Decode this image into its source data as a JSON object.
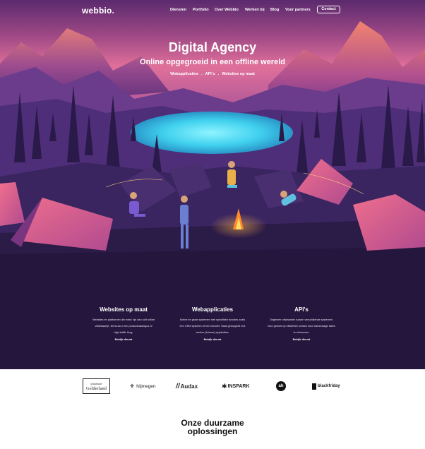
{
  "brand": {
    "logo": "webbio."
  },
  "nav": {
    "items": [
      "Diensten",
      "Portfolio",
      "Over Webbio",
      "Werken bij",
      "Blog",
      "Voor partners"
    ],
    "contact": "Contact"
  },
  "hero": {
    "title": "Digital Agency",
    "subtitle": "Online opgegroeid in een offline wereld",
    "links": [
      "Webapplicaties",
      "API´s",
      "Websites op maat"
    ],
    "separator": "."
  },
  "services": [
    {
      "title": "Websites op maat",
      "text": [
        "Websites en platformen die extra' rijn dan ooit online",
        "visitekaartje. Denk aa n een productcatalogus of",
        "high-traffic blog."
      ],
      "link": "Bekijk dienst"
    },
    {
      "title": "Webapplicaties",
      "text": [
        "Kleine en grote systemen met specifieke functies zoals",
        "een CRM systeem of een intranet. Vaak gekoppeld met",
        "andere (interne) applicaties."
      ],
      "link": "Bekijk dienst"
    },
    {
      "title": "API's",
      "text": [
        "Ongeveer uitwisselen tussen verschillende systemen.",
        "Voor gericht op efficiënter werken door handmatige taken",
        "te elimineren."
      ],
      "link": "Bekijk dienst"
    }
  ],
  "clients": [
    {
      "name": "provincie Gelderland",
      "top": "provincie",
      "bottom": "Gelderland"
    },
    {
      "name": "Nijmegen"
    },
    {
      "name": "Audax"
    },
    {
      "name": "INSPARK"
    },
    {
      "name": "ah"
    },
    {
      "name": "blackfriday"
    }
  ],
  "section": {
    "title_line1": "Onze duurzame",
    "title_line2": "oplossingen"
  },
  "colors": {
    "accent": "#e0709a",
    "dark": "#24163c",
    "lake": "#3fd6f0",
    "fire": "#ff8a2a"
  }
}
